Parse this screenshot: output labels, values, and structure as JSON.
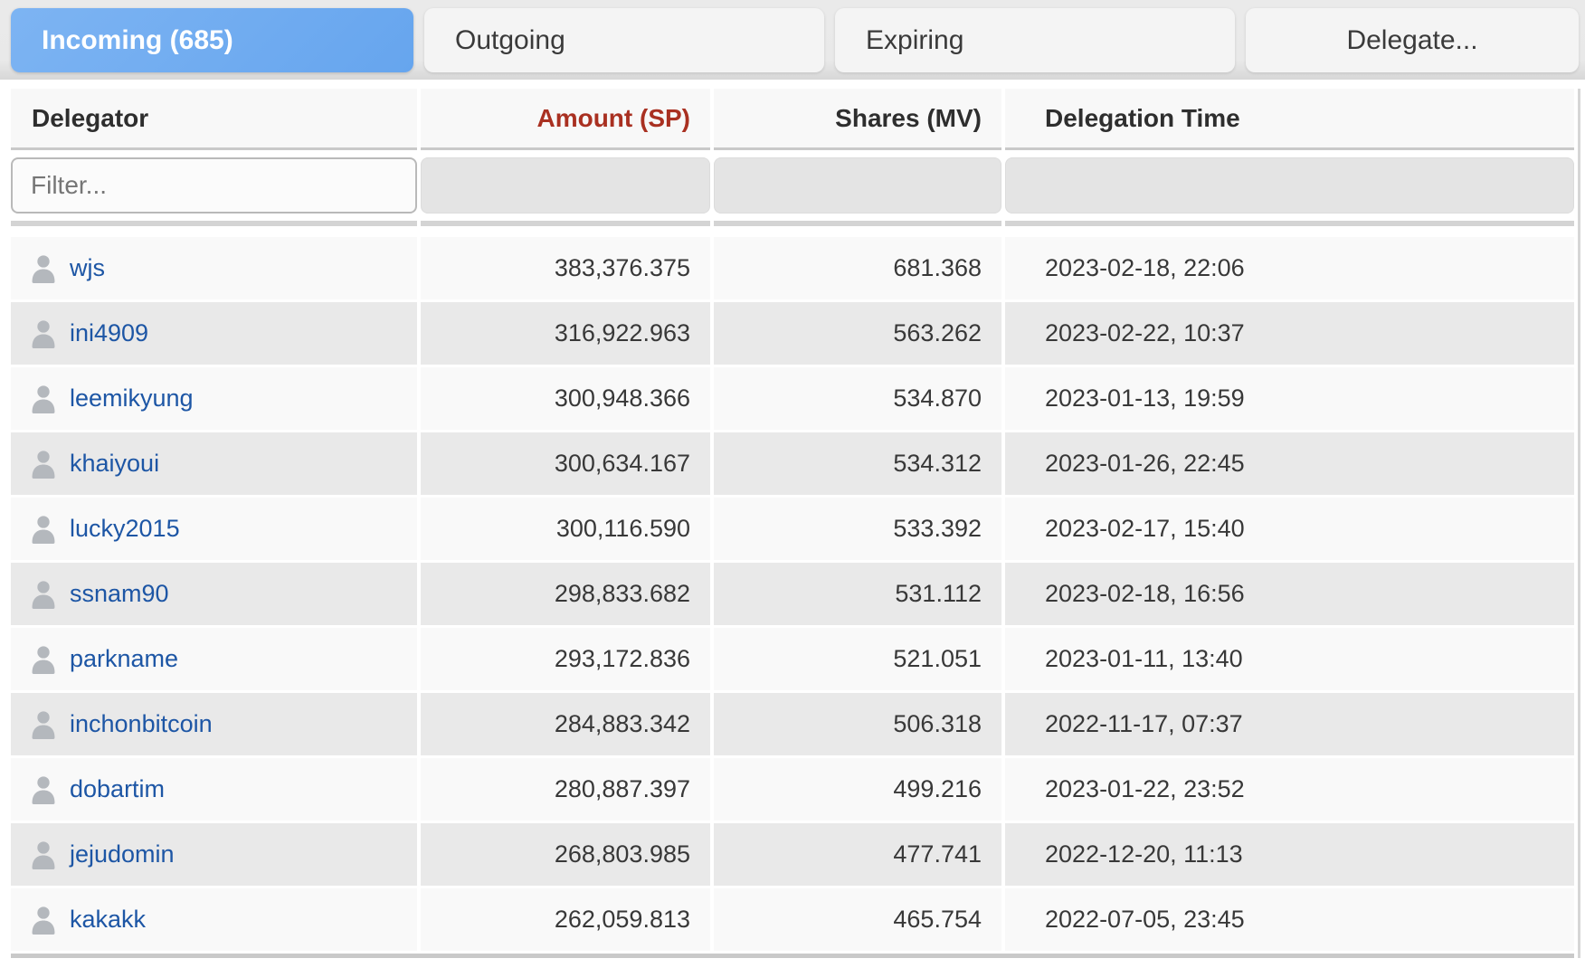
{
  "tabs": [
    {
      "id": "incoming",
      "label": "Incoming (685)",
      "active": true
    },
    {
      "id": "outgoing",
      "label": "Outgoing",
      "active": false
    },
    {
      "id": "expiring",
      "label": "Expiring",
      "active": false
    },
    {
      "id": "delegate",
      "label": "Delegate...",
      "active": false
    }
  ],
  "table": {
    "columns": [
      "Delegator",
      "Amount (SP)",
      "Shares (MV)",
      "Delegation Time"
    ],
    "sorted_column": "Amount (SP)",
    "filter_placeholder": "Filter...",
    "rows": [
      {
        "delegator": "wjs",
        "amount_sp": "383,376.375",
        "shares_mv": "681.368",
        "delegation_time": "2023-02-18, 22:06"
      },
      {
        "delegator": "ini4909",
        "amount_sp": "316,922.963",
        "shares_mv": "563.262",
        "delegation_time": "2023-02-22, 10:37"
      },
      {
        "delegator": "leemikyung",
        "amount_sp": "300,948.366",
        "shares_mv": "534.870",
        "delegation_time": "2023-01-13, 19:59"
      },
      {
        "delegator": "khaiyoui",
        "amount_sp": "300,634.167",
        "shares_mv": "534.312",
        "delegation_time": "2023-01-26, 22:45"
      },
      {
        "delegator": "lucky2015",
        "amount_sp": "300,116.590",
        "shares_mv": "533.392",
        "delegation_time": "2023-02-17, 15:40"
      },
      {
        "delegator": "ssnam90",
        "amount_sp": "298,833.682",
        "shares_mv": "531.112",
        "delegation_time": "2023-02-18, 16:56"
      },
      {
        "delegator": "parkname",
        "amount_sp": "293,172.836",
        "shares_mv": "521.051",
        "delegation_time": "2023-01-11, 13:40"
      },
      {
        "delegator": "inchonbitcoin",
        "amount_sp": "284,883.342",
        "shares_mv": "506.318",
        "delegation_time": "2022-11-17, 07:37"
      },
      {
        "delegator": "dobartim",
        "amount_sp": "280,887.397",
        "shares_mv": "499.216",
        "delegation_time": "2023-01-22, 23:52"
      },
      {
        "delegator": "jejudomin",
        "amount_sp": "268,803.985",
        "shares_mv": "477.741",
        "delegation_time": "2022-12-20, 11:13"
      },
      {
        "delegator": "kakakk",
        "amount_sp": "262,059.813",
        "shares_mv": "465.754",
        "delegation_time": "2022-07-05, 23:45"
      }
    ]
  },
  "colors": {
    "active_tab": "#6fabf0",
    "sorted_header": "#a93021",
    "link": "#1d56a5"
  }
}
